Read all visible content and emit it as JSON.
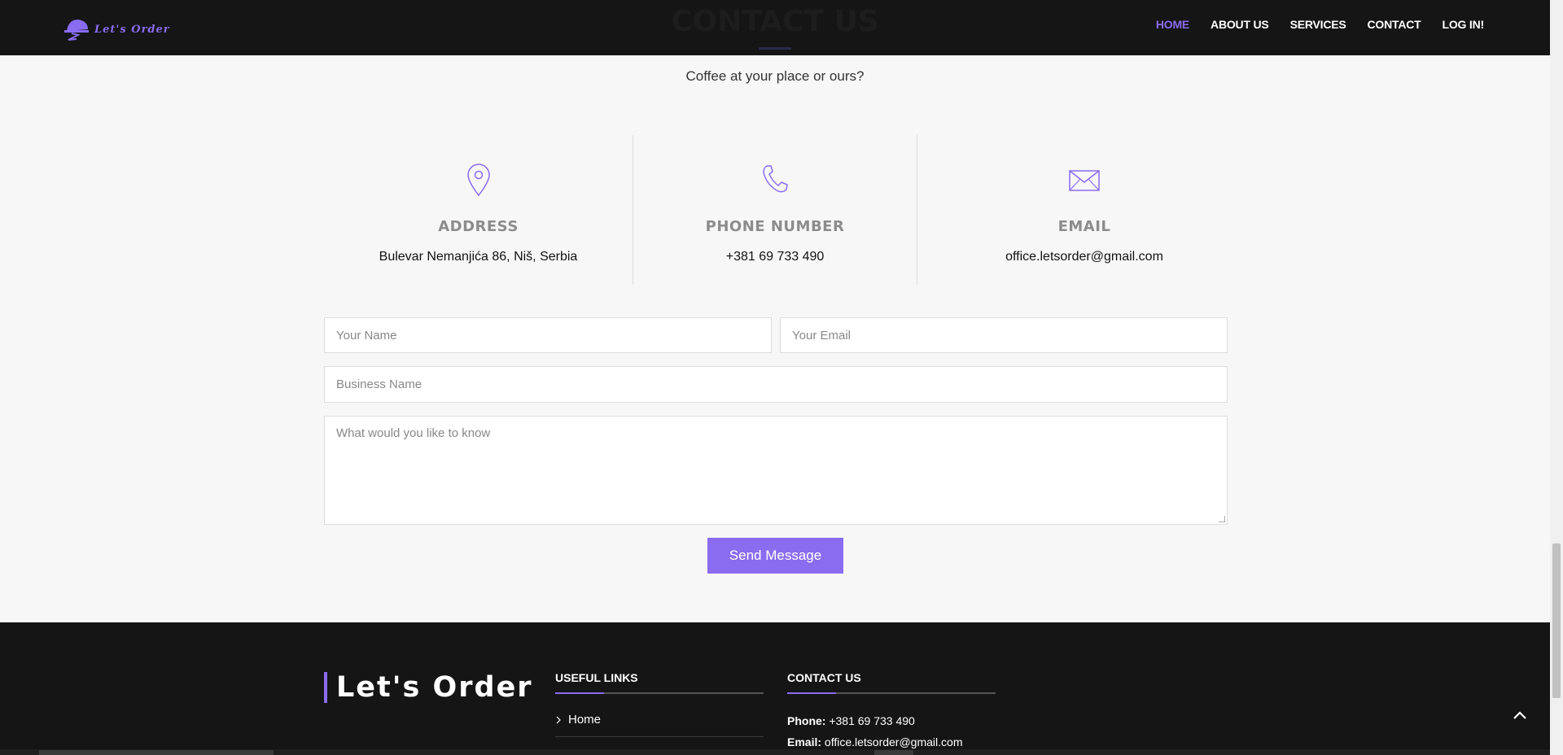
{
  "header": {
    "logo_text": "Let's Order",
    "nav": [
      {
        "label": "HOME",
        "active": true
      },
      {
        "label": "ABOUT US",
        "active": false
      },
      {
        "label": "SERVICES",
        "active": false
      },
      {
        "label": "CONTACT",
        "active": false
      },
      {
        "label": "LOG IN!",
        "active": false
      }
    ]
  },
  "contact": {
    "title": "CONTACT US",
    "subtitle": "Coffee at your place or ours?",
    "address": {
      "heading": "ADDRESS",
      "value": "Bulevar Nemanjića 86, Niš, Serbia",
      "icon": "map-pin-icon"
    },
    "phone": {
      "heading": "PHONE NUMBER",
      "value": "+381 69 733 490",
      "icon": "phone-icon"
    },
    "email": {
      "heading": "EMAIL",
      "value": "office.letsorder@gmail.com",
      "icon": "envelope-icon"
    }
  },
  "form": {
    "name_placeholder": "Your Name",
    "email_placeholder": "Your Email",
    "business_placeholder": "Business Name",
    "message_placeholder": "What would you like to know",
    "send_label": "Send Message"
  },
  "footer": {
    "brand": "Let's Order",
    "useful_links_heading": "USEFUL LINKS",
    "links": [
      "Home"
    ],
    "contact_heading": "CONTACT US",
    "phone_label": "Phone:",
    "phone_value": "+381 69 733 490",
    "email_label": "Email:",
    "email_value": "office.letsorder@gmail.com"
  },
  "colors": {
    "accent": "#8a6cf0",
    "dark": "#151515",
    "background": "#f7f7f7"
  }
}
